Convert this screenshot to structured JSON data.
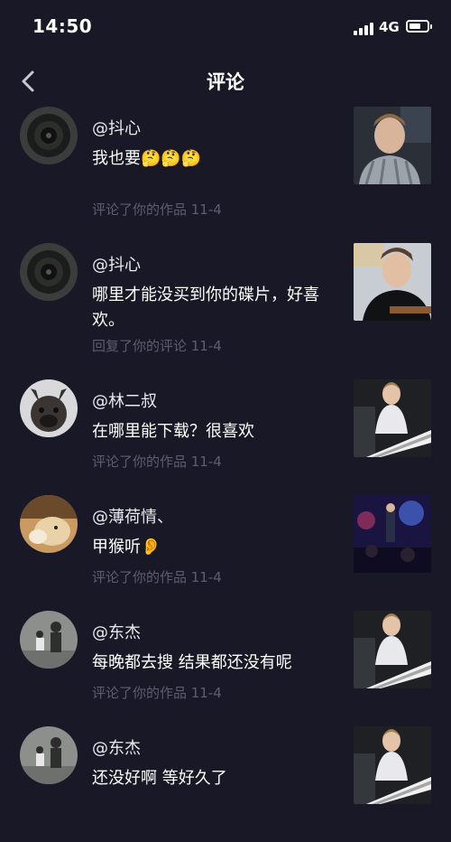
{
  "status": {
    "time": "14:50",
    "network": "4G"
  },
  "header": {
    "title": "评论"
  },
  "comments": [
    {
      "user": "@抖心",
      "text": "我也要🤔🤔🤔",
      "meta": "评论了你的作品  11-4"
    },
    {
      "user": "@抖心",
      "text": "哪里才能没买到你的碟片，好喜欢。",
      "meta": "回复了你的评论  11-4"
    },
    {
      "user": "@林二叔",
      "text": "在哪里能下载？很喜欢",
      "meta": "评论了你的作品  11-4"
    },
    {
      "user": "@薄荷情、",
      "text": "甲猴听👂",
      "meta": "评论了你的作品  11-4"
    },
    {
      "user": "@东杰",
      "text": "每晚都去搜 结果都还没有呢",
      "meta": "评论了你的作品  11-4"
    },
    {
      "user": "@东杰",
      "text": "还没好啊 等好久了",
      "meta": ""
    }
  ],
  "icons": {
    "back": "chevron-left-icon",
    "signal": "signal-bars-icon",
    "battery": "battery-icon"
  },
  "colors": {
    "background": "#181826",
    "meta": "#5d5d72",
    "text": "#ffffff"
  }
}
